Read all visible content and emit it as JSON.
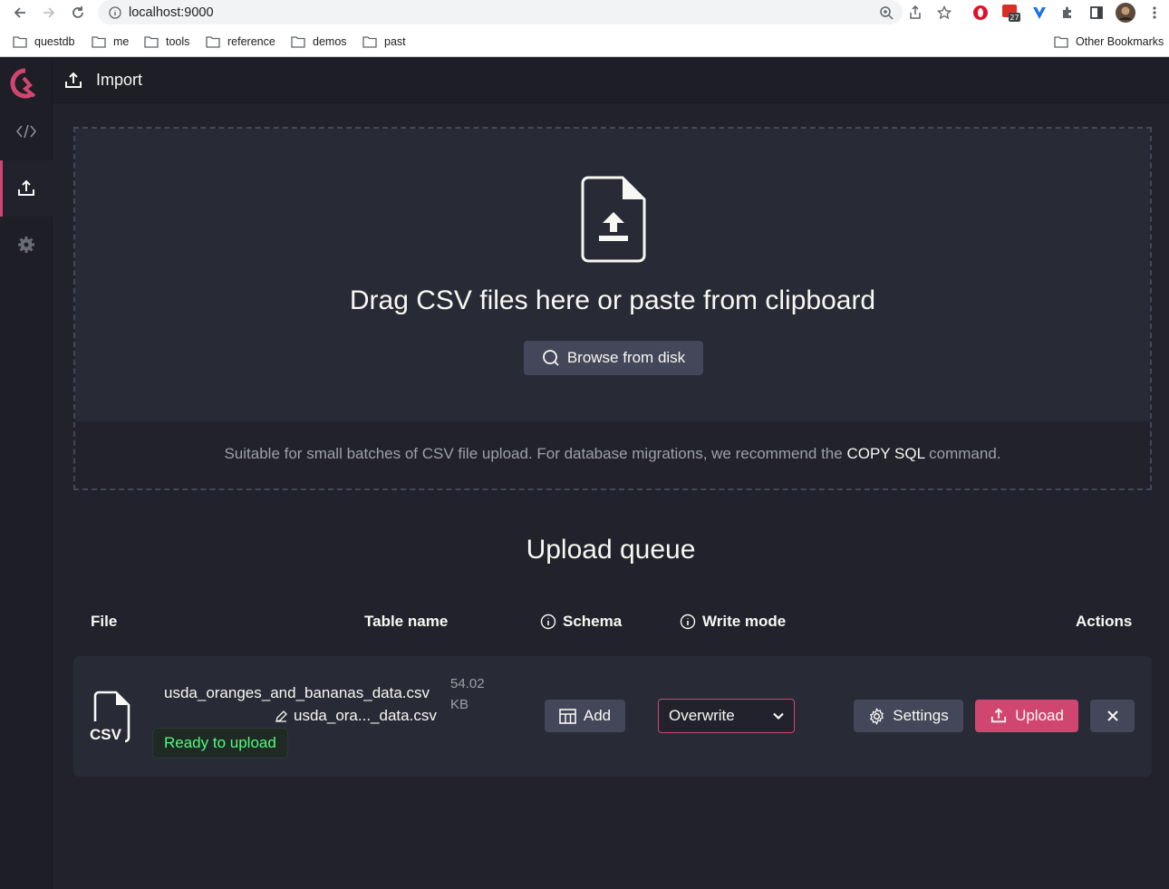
{
  "browser": {
    "url": "localhost:9000",
    "extension_badge": "27",
    "bookmarks": [
      "questdb",
      "me",
      "tools",
      "reference",
      "demos",
      "past"
    ],
    "other_bookmarks": "Other Bookmarks"
  },
  "app": {
    "page_title": "Import",
    "accent_color": "#d14671"
  },
  "dropzone": {
    "heading": "Drag CSV files here or paste from clipboard",
    "browse_label": "Browse from disk",
    "hint_prefix": "Suitable for small batches of CSV file upload. For database migrations, we recommend the ",
    "hint_link": "COPY SQL",
    "hint_suffix": " command."
  },
  "queue": {
    "title": "Upload queue",
    "columns": {
      "file": "File",
      "table_name": "Table name",
      "schema": "Schema",
      "write_mode": "Write mode",
      "actions": "Actions"
    },
    "rows": [
      {
        "file_name": "usda_oranges_and_bananas_data.csv",
        "table_name": "usda_ora..._data.csv",
        "size_value": "54.02",
        "size_unit": "KB",
        "file_type": "CSV",
        "status": "Ready to upload",
        "schema_button": "Add",
        "write_mode": "Overwrite",
        "settings_button": "Settings",
        "upload_button": "Upload"
      }
    ]
  }
}
